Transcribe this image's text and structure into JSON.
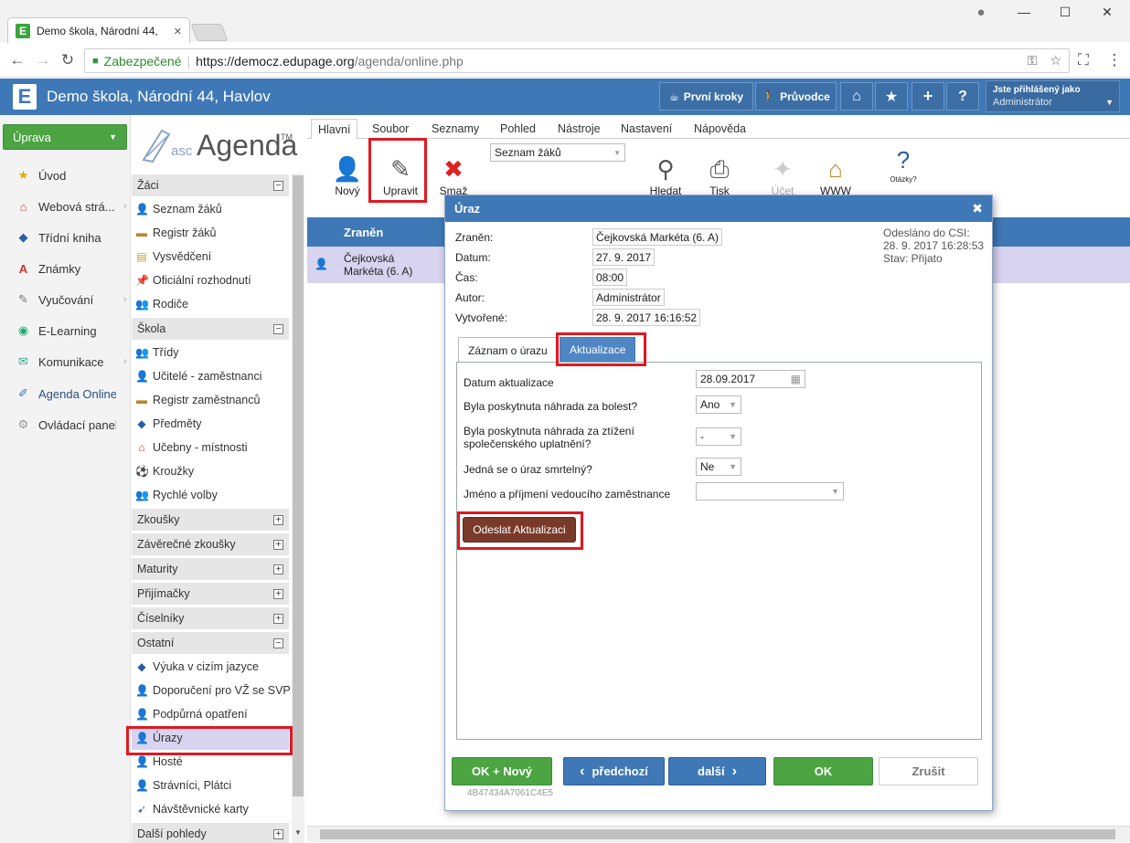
{
  "browser": {
    "tab_title": "Demo škola, Národní 44,",
    "secure_label": "Zabezpečené",
    "url_host": "https://democz.edupage.org",
    "url_path": "/agenda/online.php"
  },
  "app": {
    "title": "Demo škola, Národní 44, Havlov",
    "header_buttons": [
      "První kroky",
      "Průvodce"
    ],
    "user_line1": "Jste přihlášený jako",
    "user_line2": "Administrátor"
  },
  "leftnav": {
    "uprava": "Úprava",
    "items": [
      "Úvod",
      "Webová strá...",
      "Třídní kniha",
      "Známky",
      "Vyučování",
      "E-Learning",
      "Komunikace",
      "Agenda Online",
      "Ovládací panel"
    ]
  },
  "logo": {
    "prefix": "asc",
    "name": "Agenda",
    "tm": "TM"
  },
  "sidepanel": {
    "sections": [
      {
        "title": "Žáci",
        "toggle": "−",
        "items": [
          "Seznam žáků",
          "Registr žáků",
          "Vysvědčení",
          "Oficiální rozhodnutí",
          "Rodiče"
        ]
      },
      {
        "title": "Škola",
        "toggle": "−",
        "items": [
          "Třídy",
          "Učitelé - zaměstnanci",
          "Registr zaměstnanců",
          "Předměty",
          "Učebny - místnosti",
          "Kroužky",
          "Rychlé volby"
        ]
      },
      {
        "title": "Zkoušky",
        "toggle": "+"
      },
      {
        "title": "Závěrečné zkoušky",
        "toggle": "+"
      },
      {
        "title": "Maturity",
        "toggle": "+"
      },
      {
        "title": "Přijímačky",
        "toggle": "+"
      },
      {
        "title": "Číselníky",
        "toggle": "+"
      },
      {
        "title": "Ostatní",
        "toggle": "−",
        "items": [
          "Výuka v cizím jazyce",
          "Doporučení pro VŽ se SVP",
          "Podpůrná opatření",
          "Úrazy",
          "Hosté",
          "Strávníci, Plátci",
          "Návštěvnické karty"
        ]
      },
      {
        "title": "Další pohledy",
        "toggle": "+"
      }
    ]
  },
  "ribbon": {
    "tabs": [
      "Hlavní",
      "Soubor",
      "Seznamy",
      "Pohled",
      "Nástroje",
      "Nastavení",
      "Nápověda"
    ],
    "buttons": {
      "novy": "Nový",
      "upravit": "Upravit",
      "smaz": "Smaž",
      "hledat": "Hledat",
      "tisk": "Tisk",
      "ucet": "Účet",
      "www": "WWW",
      "otazky": "Otázky?"
    },
    "select_value": "Seznam žáků"
  },
  "grid": {
    "header": "Zraněn",
    "row_name": "Čejkovská Markéta (6. A)"
  },
  "dialog": {
    "title": "Úraz",
    "fields": [
      {
        "label": "Zraněn:",
        "value": "Čejkovská Markéta (6. A)"
      },
      {
        "label": "Datum:",
        "value": "27. 9. 2017"
      },
      {
        "label": "Čas:",
        "value": "08:00"
      },
      {
        "label": "Autor:",
        "value": "Administrátor"
      },
      {
        "label": "Vytvořené:",
        "value": "28. 9. 2017 16:16:52"
      }
    ],
    "status": [
      "Odesláno do CSI:",
      "28. 9. 2017 16:28:53",
      "Stav: Přijato"
    ],
    "tabs": [
      "Záznam o úrazu",
      "Aktualizace"
    ],
    "update": {
      "q1": "Datum aktualizace",
      "q1_value": "28.09.2017",
      "q2": "Byla poskytnuta náhrada za bolest?",
      "q2_value": "Ano",
      "q3a": "Byla poskytnuta náhrada za ztížení",
      "q3b": "společenského uplatnění?",
      "q3_value": "-",
      "q4": "Jedná se o úraz smrtelný?",
      "q4_value": "Ne",
      "q5": "Jméno a příjmení vedoucího zaměstnance",
      "q5_value": "",
      "send": "Odeslat Aktualizaci"
    },
    "footer": {
      "ok_new": "OK + Nový",
      "prev": "předchozí",
      "next": "další",
      "ok": "OK",
      "cancel": "Zrušit"
    },
    "hash": "4B47434A7061C4E5"
  },
  "colors": {
    "header_blue": "#3f78b6",
    "green": "#4ca443",
    "highlight_red": "#e01820",
    "send_brown": "#7a3a2a"
  }
}
